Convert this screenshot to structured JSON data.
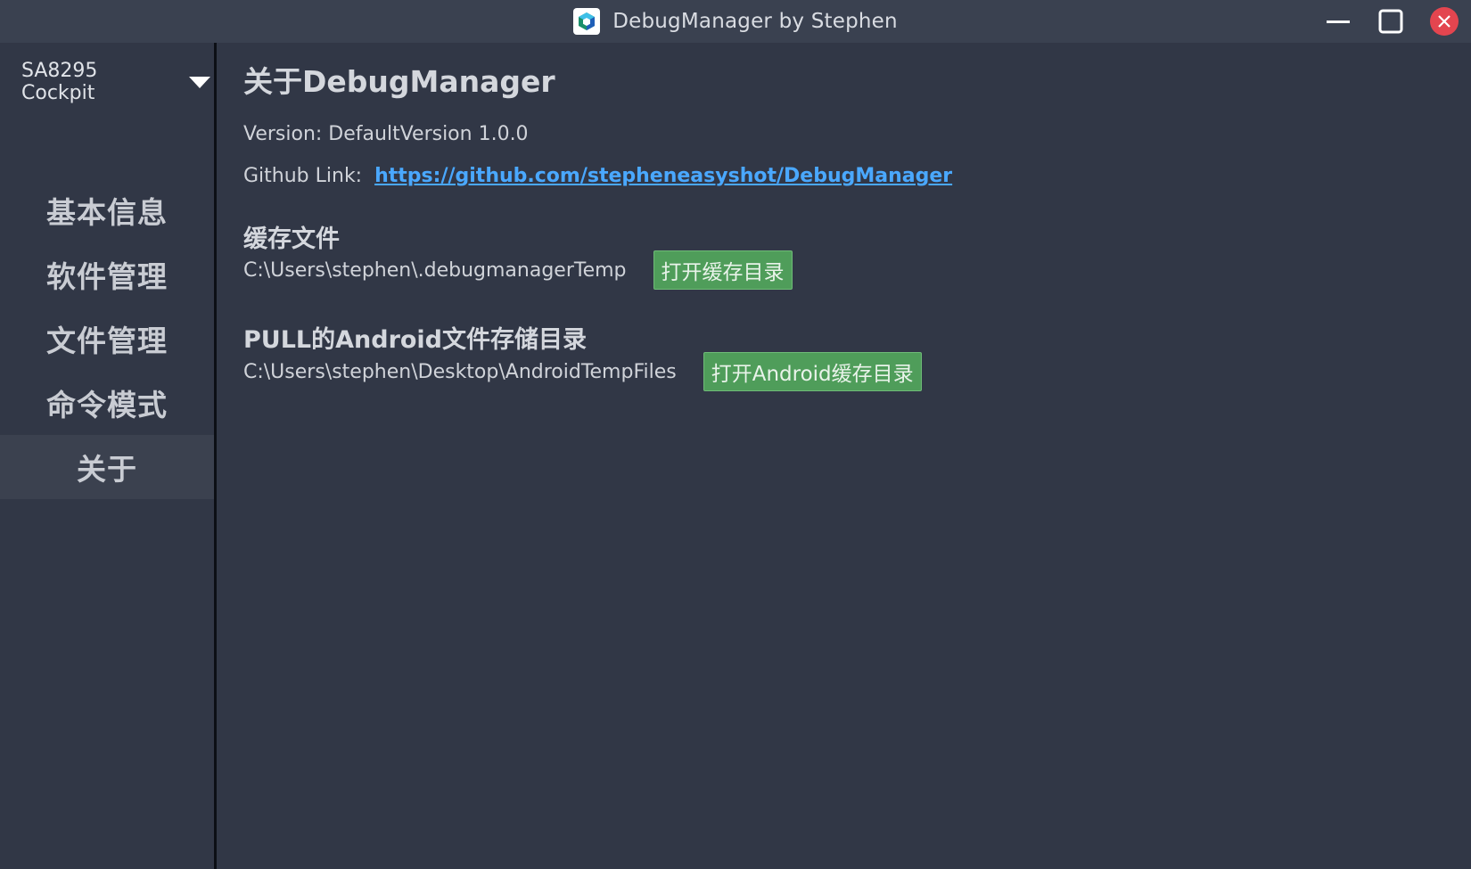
{
  "window": {
    "title": "DebugManager by Stephen",
    "accent_close": "#e3454f"
  },
  "sidebar": {
    "device_selected": "SA8295 Cockpit",
    "items": [
      {
        "label": "基本信息",
        "active": false
      },
      {
        "label": "软件管理",
        "active": false
      },
      {
        "label": "文件管理",
        "active": false
      },
      {
        "label": "命令模式",
        "active": false
      },
      {
        "label": "关于",
        "active": true
      }
    ]
  },
  "main": {
    "title": "关于DebugManager",
    "version_text": "Version: DefaultVersion 1.0.0",
    "github_label": "Github Link:",
    "github_url": "https://github.com/stepheneasyshot/DebugManager",
    "cache_section": {
      "title": "缓存文件",
      "path": "C:\\Users\\stephen\\.debugmanagerTemp",
      "button": "打开缓存目录"
    },
    "android_section": {
      "title": "PULL的Android文件存储目录",
      "path": "C:\\Users\\stephen\\Desktop\\AndroidTempFiles",
      "button": "打开Android缓存目录"
    }
  },
  "colors": {
    "background": "#313746",
    "titlebar": "#3a4150",
    "link": "#4aa8ff",
    "button_green": "#4f9d5a"
  }
}
